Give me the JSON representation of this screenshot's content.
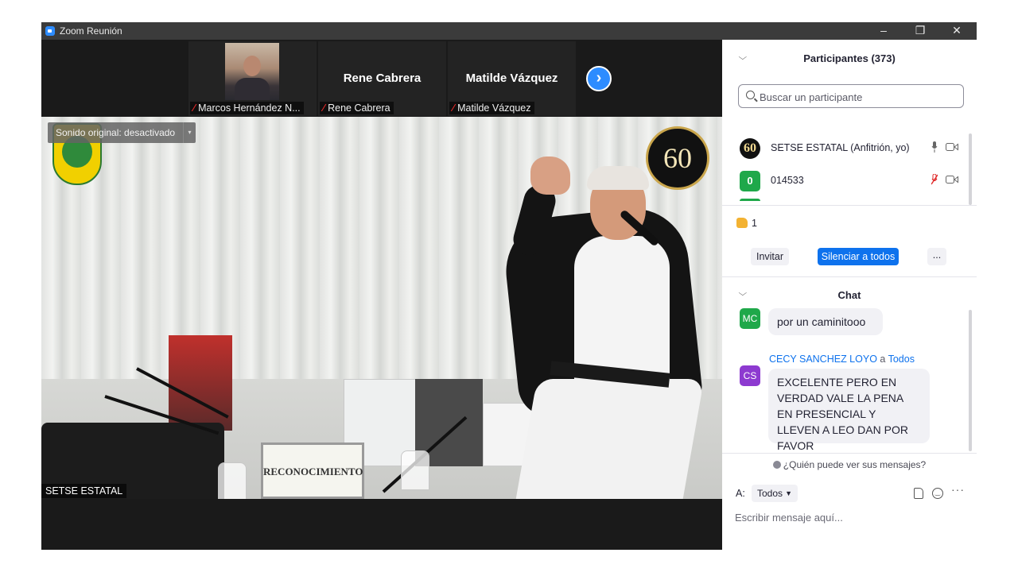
{
  "window": {
    "title": "Zoom Reunión",
    "minimize": "–",
    "maximize": "❐",
    "close": "✕"
  },
  "gallery": {
    "tiles": [
      {
        "name": "Marcos Hernández N...",
        "big_name": ""
      },
      {
        "name": "Rene Cabrera",
        "big_name": "Rene Cabrera"
      },
      {
        "name": "Matilde Vázquez",
        "big_name": "Matilde Vázquez"
      }
    ],
    "next_icon": "›"
  },
  "video": {
    "original_sound": "Sonido original: desactivado",
    "dropdown_icon": "▾",
    "speaker": "SETSE ESTATAL",
    "plaque_text": "RECONOCIMIENTO",
    "seal_text": "60"
  },
  "participants": {
    "title": "Participantes (373)",
    "search_placeholder": "Buscar un participante",
    "rows": [
      {
        "avatar": "60",
        "name": "SETSE ESTATAL (Anfitrión, yo)",
        "mic": "on",
        "camera": "on"
      },
      {
        "avatar": "0",
        "name": "014533",
        "mic": "muted",
        "camera": "on"
      }
    ],
    "reaction_count": "1",
    "invite": "Invitar",
    "mute_all": "Silenciar a todos",
    "more": "..."
  },
  "chat": {
    "title": "Chat",
    "messages": [
      {
        "initials": "MC",
        "text": "por un caminitooo"
      },
      {
        "initials": "CS",
        "sender": "CECY SANCHEZ LOYO",
        "to_word": "a",
        "recipient": "Todos",
        "text": "EXCELENTE  PERO EN VERDAD VALE LA PENA EN PRESENCIAL  Y LLEVEN A LEO DAN POR FAVOR"
      }
    ],
    "who_can_see": "¿Quién puede ver sus mensajes?",
    "to_label": "A:",
    "to_value": "Todos",
    "more": "···",
    "input_placeholder": "Escribir mensaje aquí..."
  },
  "colors": {
    "accent": "#0e72ed",
    "zoom_blue": "#2d8cff",
    "mute_red": "#e02828",
    "avatar_green": "#1fa84a",
    "avatar_purple": "#8d3ad0"
  },
  "icons": [
    "zoom-app-icon",
    "minimize-icon",
    "maximize-icon",
    "close-icon",
    "mic-muted-icon",
    "next-page-icon",
    "chevron-down-icon",
    "search-icon",
    "mic-icon",
    "camera-icon",
    "thumbs-up-icon",
    "file-icon",
    "emoji-icon",
    "more-icon"
  ]
}
